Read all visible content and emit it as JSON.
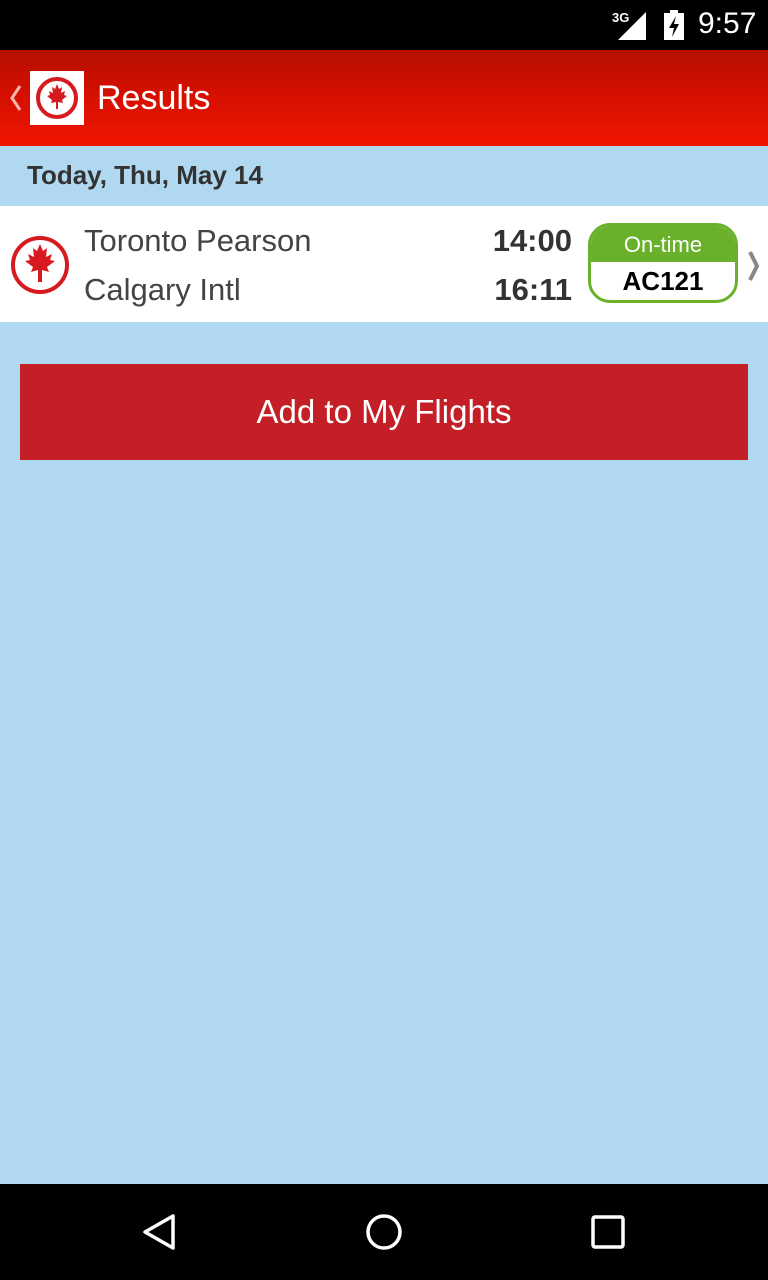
{
  "status_bar": {
    "network": "3G",
    "time": "9:57",
    "icons": [
      "signal-icon",
      "battery-icon"
    ]
  },
  "app_bar": {
    "back_icon": "chevron-left-icon",
    "logo": "air-canada-maple-leaf-logo",
    "title": "Results"
  },
  "date_header": {
    "text": "Today, Thu, May 14"
  },
  "flights": [
    {
      "origin": "Toronto Pearson",
      "destination": "Calgary Intl",
      "departure_time": "14:00",
      "arrival_time": "16:11",
      "status": "On-time",
      "flight_number": "AC121",
      "status_color": "#69b12a",
      "chevron_icon": "chevron-right-icon"
    }
  ],
  "actions": {
    "add_label": "Add to My Flights",
    "button_color": "#c41f26"
  },
  "nav_bar": {
    "icons": [
      "back-triangle-icon",
      "home-circle-icon",
      "recents-square-icon"
    ]
  },
  "colors": {
    "app_bar": "#e01100",
    "background": "#b0d8f1",
    "brand_red": "#d71920"
  }
}
